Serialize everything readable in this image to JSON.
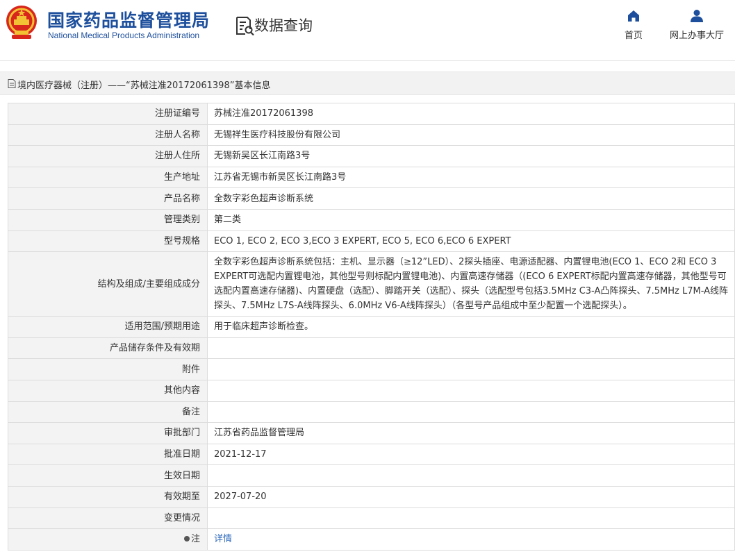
{
  "header": {
    "emblem_icon": "national-emblem-icon",
    "title_cn": "国家药品监督管理局",
    "title_en": "National Medical Products Administration",
    "query_icon": "data-query-icon",
    "query_label": "数据查询",
    "nav": {
      "home_icon": "home-icon",
      "home_label": "首页",
      "office_icon": "user-icon",
      "office_label": "网上办事大厅"
    }
  },
  "breadcrumb": {
    "icon": "document-icon",
    "text": "境内医疗器械（注册）——“苏械注准20172061398”基本信息"
  },
  "colors": {
    "brand_blue": "#1d4f9c",
    "link_blue": "#2f6bbd",
    "label_bg": "#f3f3f3",
    "border": "#dcdcdc"
  },
  "fields": [
    {
      "label": "注册证编号",
      "value": "苏械注准20172061398"
    },
    {
      "label": "注册人名称",
      "value": "无锡祥生医疗科技股份有限公司"
    },
    {
      "label": "注册人住所",
      "value": "无锡新吴区长江南路3号"
    },
    {
      "label": "生产地址",
      "value": "江苏省无锡市新吴区长江南路3号"
    },
    {
      "label": "产品名称",
      "value": "全数字彩色超声诊断系统"
    },
    {
      "label": "管理类别",
      "value": "第二类"
    },
    {
      "label": "型号规格",
      "value": "ECO 1, ECO 2, ECO 3,ECO 3 EXPERT, ECO 5, ECO 6,ECO 6 EXPERT"
    },
    {
      "label": "结构及组成/主要组成成分",
      "value": "全数字彩色超声诊断系统包括：主机、显示器（≥12”LED）、2探头插座、电源适配器、内置锂电池(ECO 1、ECO 2和 ECO 3 EXPERT可选配内置锂电池，其他型号则标配内置锂电池)、内置高速存储器（(ECO 6 EXPERT标配内置高速存储器，其他型号可选配内置高速存储器)、内置硬盘（选配）、脚踏开关（选配）、探头（选配型号包括3.5MHz C3-A凸阵探头、7.5MHz L7M-A线阵探头、7.5MHz L7S-A线阵探头、6.0MHz V6-A线阵探头）（各型号产品组成中至少配置一个选配探头）。"
    },
    {
      "label": "适用范围/预期用途",
      "value": "用于临床超声诊断检查。"
    },
    {
      "label": "产品储存条件及有效期",
      "value": ""
    },
    {
      "label": "附件",
      "value": ""
    },
    {
      "label": "其他内容",
      "value": ""
    },
    {
      "label": "备注",
      "value": ""
    },
    {
      "label": "审批部门",
      "value": "江苏省药品监督管理局"
    },
    {
      "label": "批准日期",
      "value": "2021-12-17"
    },
    {
      "label": "生效日期",
      "value": ""
    },
    {
      "label": "有效期至",
      "value": "2027-07-20"
    },
    {
      "label": "变更情况",
      "value": ""
    }
  ],
  "note_row": {
    "icon": "bullet-icon",
    "label": "注",
    "link_text": "详情"
  }
}
